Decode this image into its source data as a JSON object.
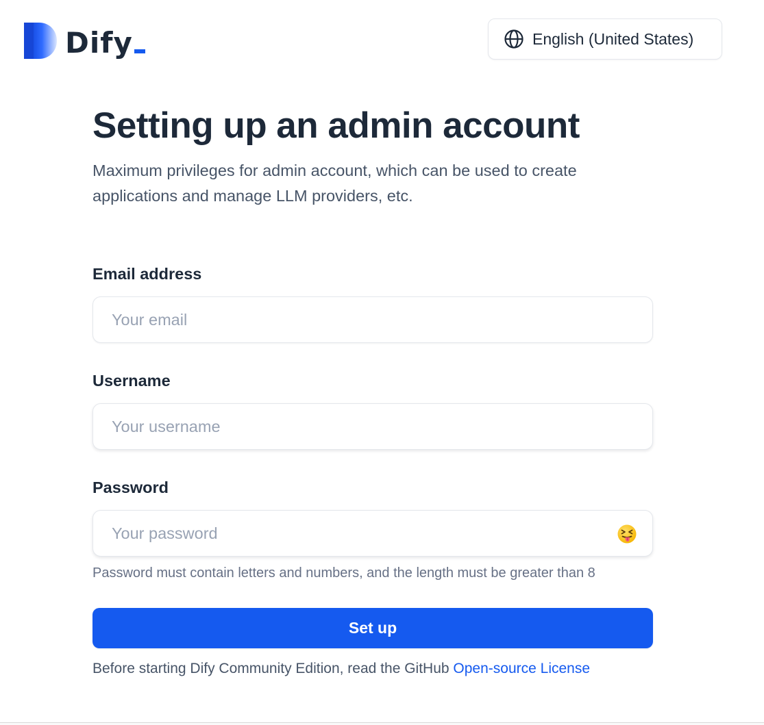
{
  "header": {
    "logo_text": "Dify",
    "language": {
      "label": "English (United States)",
      "icon": "globe-icon"
    }
  },
  "main": {
    "title": "Setting up an admin account",
    "subtitle": "Maximum privileges for admin account, which can be used to create applications and manage LLM providers, etc.",
    "fields": {
      "email": {
        "label": "Email address",
        "placeholder": "Your email",
        "value": ""
      },
      "username": {
        "label": "Username",
        "placeholder": "Your username",
        "value": ""
      },
      "password": {
        "label": "Password",
        "placeholder": "Your password",
        "value": "",
        "toggle_icon": "face-with-tongue-closed-eyes-emoji",
        "toggle_glyph": "😝",
        "hint": "Password must contain letters and numbers, and the length must be greater than 8"
      }
    },
    "submit_label": "Set up",
    "footer": {
      "text": "Before starting Dify Community Edition, read the GitHub ",
      "link_text": "Open-source License"
    }
  },
  "colors": {
    "accent": "#155aef",
    "title": "#1d2939",
    "body": "#475467",
    "placeholder": "#98a2b3",
    "border": "#e4e7ec"
  }
}
